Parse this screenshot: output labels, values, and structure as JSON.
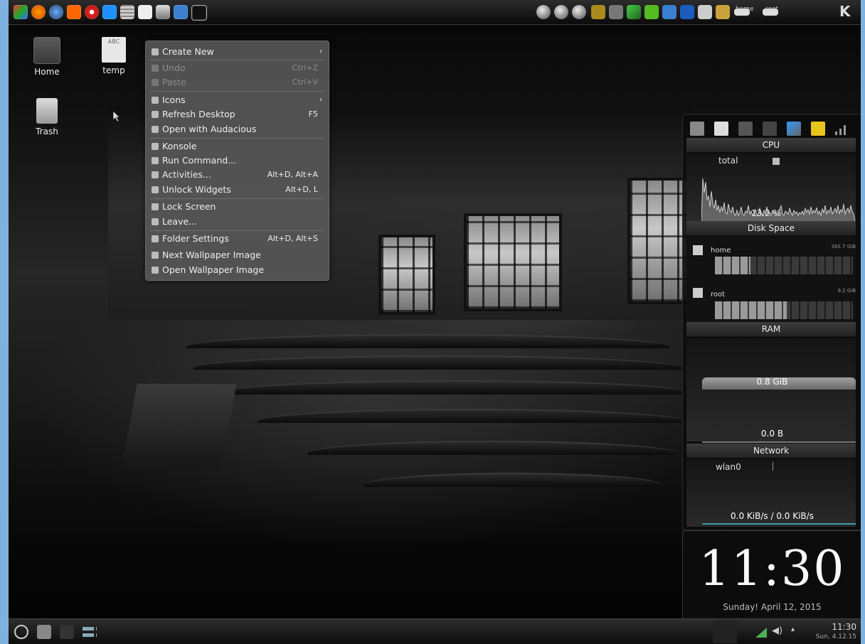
{
  "desktop": {
    "icons": [
      {
        "label": "Home",
        "icon": "folder-home-icon"
      },
      {
        "label": "temp",
        "icon": "text-file-icon",
        "badge": "ABC"
      },
      {
        "label": "Trash",
        "icon": "trash-icon"
      }
    ]
  },
  "context_menu": {
    "items": [
      {
        "label": "Create New",
        "shortcut": "",
        "submenu": true,
        "enabled": true,
        "icon": "create-new-icon"
      },
      {
        "label": "Undo",
        "shortcut": "Ctrl+Z",
        "submenu": false,
        "enabled": false,
        "icon": "undo-icon"
      },
      {
        "label": "Paste",
        "shortcut": "Ctrl+V",
        "submenu": false,
        "enabled": false,
        "icon": "paste-icon"
      },
      {
        "label": "Icons",
        "shortcut": "",
        "submenu": true,
        "enabled": true,
        "icon": "icons-icon"
      },
      {
        "label": "Refresh Desktop",
        "shortcut": "F5",
        "submenu": false,
        "enabled": true,
        "icon": "refresh-icon"
      },
      {
        "label": "Open with Audacious",
        "shortcut": "",
        "submenu": false,
        "enabled": true,
        "icon": "audacious-icon"
      },
      {
        "label": "Konsole",
        "shortcut": "",
        "submenu": false,
        "enabled": true,
        "icon": "konsole-icon"
      },
      {
        "label": "Run Command...",
        "shortcut": "",
        "submenu": false,
        "enabled": true,
        "icon": "run-command-icon"
      },
      {
        "label": "Activities...",
        "shortcut": "Alt+D, Alt+A",
        "submenu": false,
        "enabled": true,
        "icon": "activities-icon"
      },
      {
        "label": "Unlock Widgets",
        "shortcut": "Alt+D, L",
        "submenu": false,
        "enabled": true,
        "icon": "lock-icon"
      },
      {
        "label": "Lock Screen",
        "shortcut": "",
        "submenu": false,
        "enabled": true,
        "icon": "lock-screen-icon"
      },
      {
        "label": "Leave...",
        "shortcut": "",
        "submenu": false,
        "enabled": true,
        "icon": "leave-icon"
      },
      {
        "label": "Folder Settings",
        "shortcut": "Alt+D, Alt+S",
        "submenu": false,
        "enabled": true,
        "icon": "settings-icon"
      },
      {
        "label": "Next Wallpaper Image",
        "shortcut": "",
        "submenu": false,
        "enabled": true,
        "icon": "wallpaper-next-icon"
      },
      {
        "label": "Open Wallpaper Image",
        "shortcut": "",
        "submenu": false,
        "enabled": true,
        "icon": "wallpaper-open-icon"
      }
    ]
  },
  "top_panel": {
    "disk_tabs": [
      "home",
      "root"
    ],
    "kde_logo": "K"
  },
  "system_monitor": {
    "cpu": {
      "title": "CPU",
      "label": "total",
      "value": "13.2 %"
    },
    "disk": {
      "title": "Disk Space",
      "entries": [
        {
          "name": "home",
          "size": "391.7 GiB",
          "used_fraction": 0.26
        },
        {
          "name": "root",
          "size": "9.2 GiB",
          "used_fraction": 0.52
        }
      ]
    },
    "ram": {
      "title": "RAM",
      "used": "0.8 GiB",
      "swap": "0.0 B"
    },
    "network": {
      "title": "Network",
      "interface": "wlan0",
      "rate": "0.0 KiB/s / 0.0 KiB/s"
    }
  },
  "clock": {
    "time": "11:30",
    "date": "Sunday! April 12, 2015"
  },
  "bottom_panel": {
    "tray_time": "11:30",
    "tray_date": "Sun, 4.12.15"
  },
  "colors": {
    "frame": "#7fb1de",
    "menu_bg": "#565656",
    "panel_bg": "#1a1a1a"
  }
}
